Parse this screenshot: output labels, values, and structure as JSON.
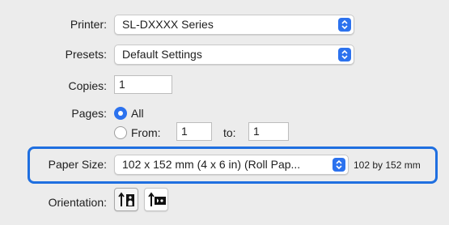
{
  "printer": {
    "label": "Printer:",
    "value": "SL-DXXXX Series"
  },
  "presets": {
    "label": "Presets:",
    "value": "Default Settings"
  },
  "copies": {
    "label": "Copies:",
    "value": "1"
  },
  "pages": {
    "label": "Pages:",
    "all_label": "All",
    "from_label": "From:",
    "from_value": "1",
    "to_label": "to:",
    "to_value": "1",
    "selected": "All"
  },
  "paper_size": {
    "label": "Paper Size:",
    "value": "102 x 152 mm (4 x 6 in) (Roll Pap...",
    "dimensions": "102 by 152 mm"
  },
  "orientation": {
    "label": "Orientation:",
    "options": [
      "portrait-icon",
      "landscape-icon"
    ],
    "selected": "portrait"
  },
  "colors": {
    "accent": "#2c72ee",
    "highlight": "#1f6fe0",
    "background": "#ececec"
  }
}
